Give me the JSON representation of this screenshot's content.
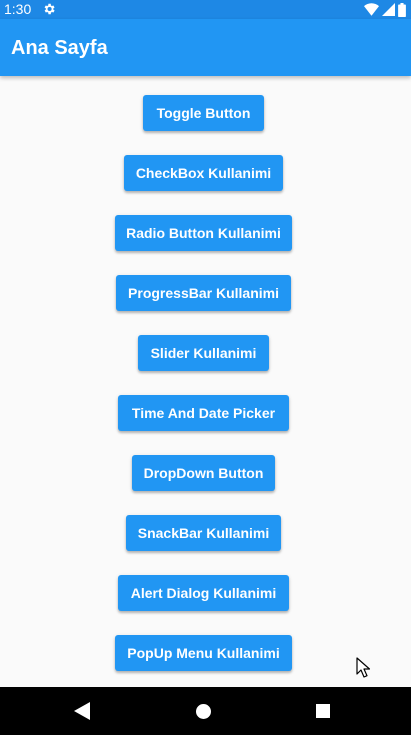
{
  "status_bar": {
    "time": "1:30",
    "icons": [
      "settings-gear-icon",
      "wifi-icon",
      "cellular-signal-icon",
      "battery-icon"
    ]
  },
  "app_bar": {
    "title": "Ana Sayfa"
  },
  "buttons": [
    {
      "label": "Toggle Button"
    },
    {
      "label": "CheckBox Kullanimi"
    },
    {
      "label": "Radio Button Kullanimi"
    },
    {
      "label": "ProgressBar Kullanimi"
    },
    {
      "label": "Slider Kullanimi"
    },
    {
      "label": "Time And Date Picker"
    },
    {
      "label": "DropDown Button"
    },
    {
      "label": "SnackBar Kullanimi"
    },
    {
      "label": "Alert Dialog Kullanimi"
    },
    {
      "label": "PopUp Menu Kullanimi"
    }
  ],
  "nav_bar": {
    "icons": [
      "back-icon",
      "home-icon",
      "recents-icon"
    ]
  },
  "colors": {
    "status_bar": "#1e88e5",
    "app_bar": "#2196f3",
    "button": "#2196f3",
    "background": "#fafafa",
    "nav_bar": "#000000"
  }
}
